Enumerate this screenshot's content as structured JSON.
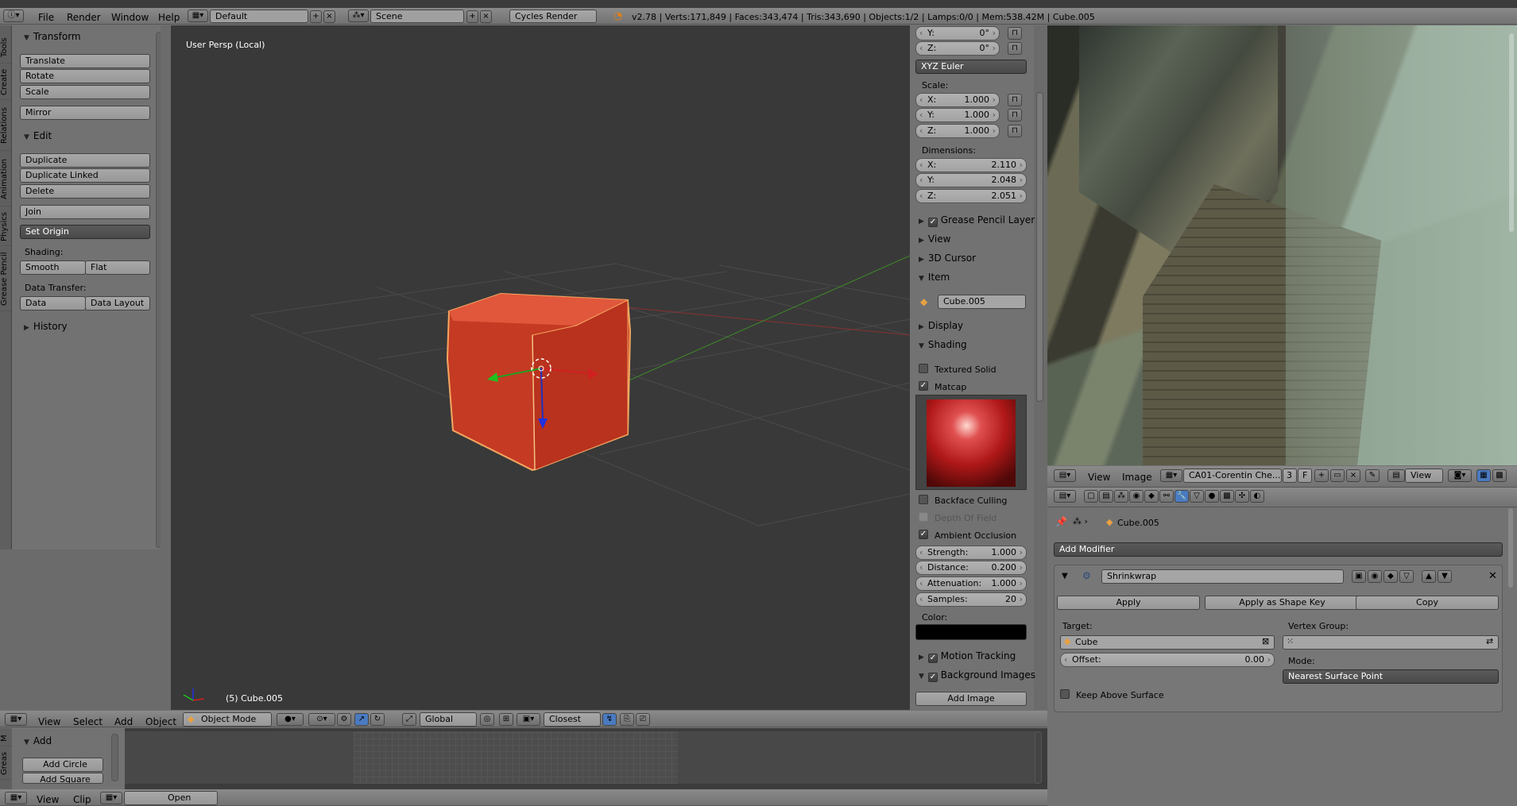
{
  "topbar": {
    "menus": [
      "File",
      "Render",
      "Window",
      "Help"
    ],
    "layout": "Default",
    "scene": "Scene",
    "engine": "Cycles Render",
    "stats": "v2.78 | Verts:171,849 | Faces:343,474 | Tris:343,690 | Objects:1/2 | Lamps:0/0 | Mem:538.42M | Cube.005"
  },
  "tools": {
    "sidetabs": [
      "Tools",
      "Create",
      "Relations",
      "Animation",
      "Physics",
      "Grease Pencil"
    ],
    "transform": "Transform",
    "translate": "Translate",
    "rotate": "Rotate",
    "scale": "Scale",
    "mirror": "Mirror",
    "edit": "Edit",
    "duplicate": "Duplicate",
    "duplicate_linked": "Duplicate Linked",
    "delete": "Delete",
    "join": "Join",
    "set_origin": "Set Origin",
    "shading_label": "Shading:",
    "smooth": "Smooth",
    "flat": "Flat",
    "data_transfer_label": "Data Transfer:",
    "data": "Data",
    "data_layout": "Data Layout",
    "history": "History"
  },
  "viewport": {
    "view_label": "User Persp (Local)",
    "object_label": "(5) Cube.005"
  },
  "props": {
    "rot_y": "Y:",
    "rot_y_val": "0°",
    "rot_z": "Z:",
    "rot_z_val": "0°",
    "rot_mode": "XYZ Euler",
    "scale_label": "Scale:",
    "sx": "1.000",
    "sy": "1.000",
    "sz": "1.000",
    "dim_label": "Dimensions:",
    "dx": "2.110",
    "dy": "2.048",
    "dz": "2.051",
    "x": "X:",
    "y": "Y:",
    "z": "Z:",
    "grease": "Grease Pencil Layer",
    "view": "View",
    "cursor": "3D Cursor",
    "item": "Item",
    "item_name": "Cube.005",
    "display": "Display",
    "shading": "Shading",
    "textured_solid": "Textured Solid",
    "matcap": "Matcap",
    "backface": "Backface Culling",
    "dof": "Depth Of Field",
    "ao": "Ambient Occlusion",
    "strength_l": "Strength:",
    "strength": "1.000",
    "distance_l": "Distance:",
    "distance": "0.200",
    "atten_l": "Attenuation:",
    "atten": "1.000",
    "samples_l": "Samples:",
    "samples": "20",
    "color_l": "Color:",
    "motion": "Motion Tracking",
    "bgimages": "Background Images",
    "add_image": "Add Image"
  },
  "view3d_header": {
    "view": "View",
    "select": "Select",
    "add": "Add",
    "object": "Object",
    "mode": "Object Mode",
    "orientation": "Global",
    "snap": "Closest"
  },
  "bottom": {
    "add": "Add",
    "add_circle": "Add Circle",
    "add_square": "Add Square",
    "view": "View",
    "clip": "Clip",
    "open": "Open",
    "tabs": [
      "M",
      "Greas"
    ]
  },
  "image_editor": {
    "view": "View",
    "image": "Image",
    "image_name": "CA01-Corentin Che...",
    "users": "3",
    "fake": "F",
    "view_btn": "View"
  },
  "modifier": {
    "breadcrumb": "Cube.005",
    "add_modifier": "Add Modifier",
    "name": "Shrinkwrap",
    "apply": "Apply",
    "apply_shape": "Apply as Shape Key",
    "copy": "Copy",
    "target_l": "Target:",
    "target": "Cube",
    "vgroup_l": "Vertex Group:",
    "offset_l": "Offset:",
    "offset": "0.00",
    "mode_l": "Mode:",
    "mode": "Nearest Surface Point",
    "keep_above": "Keep Above Surface"
  }
}
